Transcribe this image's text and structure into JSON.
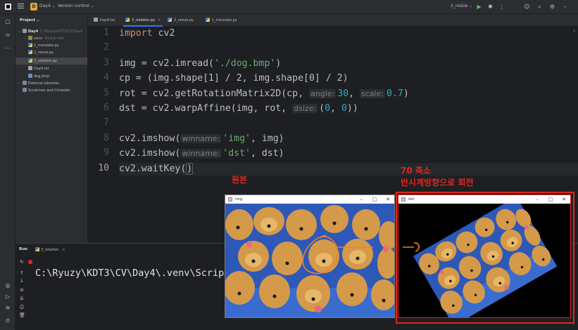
{
  "titlebar": {
    "project_badge": "D",
    "project_name": "Day4",
    "vcs_label": "Version control",
    "run_config": "2_resize",
    "icons": [
      "app-logo",
      "hamburger-menu",
      "play-icon",
      "debug-icon",
      "more-icon",
      "add-user-icon",
      "search-icon",
      "settings-icon",
      "minimize-icon",
      "maximize-icon",
      "close-icon"
    ]
  },
  "project_panel": {
    "header": "Project",
    "root": "Day4",
    "root_path": "C:\\Ryuzy\\KDT3\\CV\\Day4",
    "items": [
      {
        "label": "venv",
        "extra": "library root",
        "kind": "venv"
      },
      {
        "label": "1_translate.py",
        "kind": "py"
      },
      {
        "label": "2_resize.py",
        "kind": "py"
      },
      {
        "label": "3_rotation.py",
        "kind": "py"
      },
      {
        "label": "Day4.txt",
        "kind": "txt"
      },
      {
        "label": "dog.bmp",
        "kind": "bmp"
      }
    ],
    "external": "External Libraries",
    "scratches": "Scratches and Consoles"
  },
  "tabs": [
    {
      "label": "Day4.txt",
      "active": false
    },
    {
      "label": "3_rotation.py",
      "active": true
    },
    {
      "label": "2_resize.py",
      "active": false
    },
    {
      "label": "1_translate.py",
      "active": false
    }
  ],
  "editor": {
    "line_numbers": [
      "1",
      "2",
      "3",
      "4",
      "5",
      "6",
      "7",
      "8",
      "9",
      "10"
    ],
    "l1_kw": "import",
    "l1_rest": " cv2",
    "l3_a": "img = cv2.imread(",
    "l3_str": "'./dog.bmp'",
    "l3_b": ")",
    "l4": "cp = (img.shape[1] / 2, img.shape[0] / 2)",
    "l5_a": "rot = cv2.getRotationMatrix2D(cp, ",
    "l5_hint1": "angle:",
    "l5_num1": "30",
    "l5_sep": ", ",
    "l5_hint2": "scale:",
    "l5_num2": "0.7",
    "l5_b": ")",
    "l6_a": "dst = cv2.warpAffine(img, rot, ",
    "l6_hint": "dsize:",
    "l6_b": "(",
    "l6_n1": "0",
    "l6_c": ", ",
    "l6_n2": "0",
    "l6_d": "))",
    "l8_a": "cv2.imshow(",
    "l8_hint": "winname:",
    "l8_str": "'img'",
    "l8_b": ", img)",
    "l9_a": "cv2.imshow(",
    "l9_hint": "winname:",
    "l9_str": "'dst'",
    "l9_b": ", dst)",
    "l10_a": "cv2.waitKey(",
    "l10_b": ")",
    "scroll_count": "3"
  },
  "run": {
    "label": "Run",
    "tab": "3_rotation",
    "output": "C:\\Ryuzy\\KDT3\\CV\\Day4\\.venv\\Script"
  },
  "annotations": {
    "original": "원본",
    "line1": "70 축소",
    "line2": "반시계방향으로 회전"
  },
  "windows": {
    "img_title": "img",
    "dst_title": "dst"
  },
  "colors": {
    "annotation_red": "#e0271f",
    "sketch_orange": "#f0821e",
    "accent_blue": "#3574f0"
  }
}
